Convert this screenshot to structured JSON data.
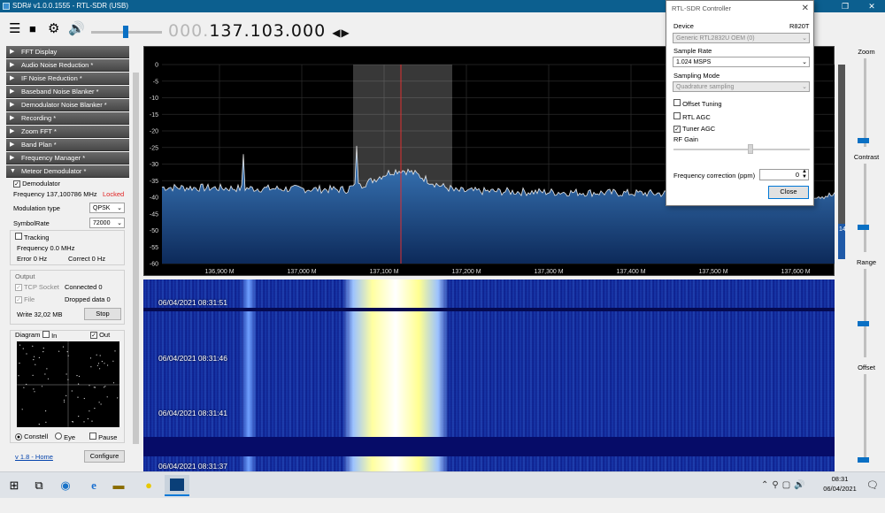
{
  "window": {
    "title": "SDR# v1.0.0.1555 - RTL-SDR (USB)"
  },
  "toolbar": {
    "freq_dim": "000.",
    "freq_main": "137.103.000",
    "freq_arrows": "◀▶"
  },
  "left": {
    "sections": [
      "FFT Display",
      "Audio Noise Reduction *",
      "IF Noise Reduction *",
      "Baseband Noise Blanker *",
      "Demodulator Noise Blanker *",
      "Recording *",
      "Zoom FFT *",
      "Band Plan *",
      "Frequency Manager *",
      "Meteor Demodulator *"
    ],
    "demod": {
      "title": "Demodulator",
      "frequency": "Frequency 137,100786 MHz",
      "status": "Locked",
      "modulation_label": "Modulation type",
      "modulation_value": "QPSK",
      "symbolrate_label": "SymbolRate",
      "symbolrate_value": "72000",
      "tracking": "Tracking",
      "track_freq": "Frequency 0.0 MHz",
      "error": "Error 0 Hz",
      "correct": "Correct 0 Hz",
      "output_title": "Output",
      "tcp": "TCP Socket",
      "connected": "Connected 0",
      "file": "File",
      "dropped": "Dropped data 0",
      "write": "Write 32,02 MB",
      "stop": "Stop",
      "diagram": "Diagram",
      "in": "In",
      "out": "Out",
      "constell": "Constell",
      "eye": "Eye",
      "pause": "Pause",
      "link": "v 1.8 - Home",
      "configure": "Configure"
    }
  },
  "spectrum": {
    "ylabels": [
      "0",
      "-5",
      "-10",
      "-15",
      "-20",
      "-25",
      "-30",
      "-35",
      "-40",
      "-45",
      "-50",
      "-55",
      "-60"
    ],
    "xlabels": [
      "136,900 M",
      "137,000 M",
      "137,100 M",
      "137,200 M",
      "137,300 M",
      "137,400 M",
      "137,500 M",
      "137,600 M"
    ],
    "level_value": "14"
  },
  "waterfall": {
    "timestamps": [
      "06/04/2021 08:31:51",
      "06/04/2021 08:31:46",
      "06/04/2021 08:31:41",
      "06/04/2021 08:31:37"
    ]
  },
  "right": {
    "zoom": "Zoom",
    "contrast": "Contrast",
    "range": "Range",
    "offset": "Offset"
  },
  "dialog": {
    "title": "RTL-SDR Controller",
    "device_label": "Device",
    "device_tuner": "R820T",
    "device_value": "Generic RTL2832U OEM (0)",
    "samplerate_label": "Sample Rate",
    "samplerate_value": "1.024 MSPS",
    "sampling_label": "Sampling Mode",
    "sampling_value": "Quadrature sampling",
    "offset_tuning": "Offset Tuning",
    "rtl_agc": "RTL AGC",
    "tuner_agc": "Tuner AGC",
    "rf_gain": "RF Gain",
    "freqcorr_label": "Frequency correction (ppm)",
    "freqcorr_value": "0",
    "close": "Close"
  },
  "taskbar": {
    "time": "08:31",
    "date": "06/04/2021"
  }
}
